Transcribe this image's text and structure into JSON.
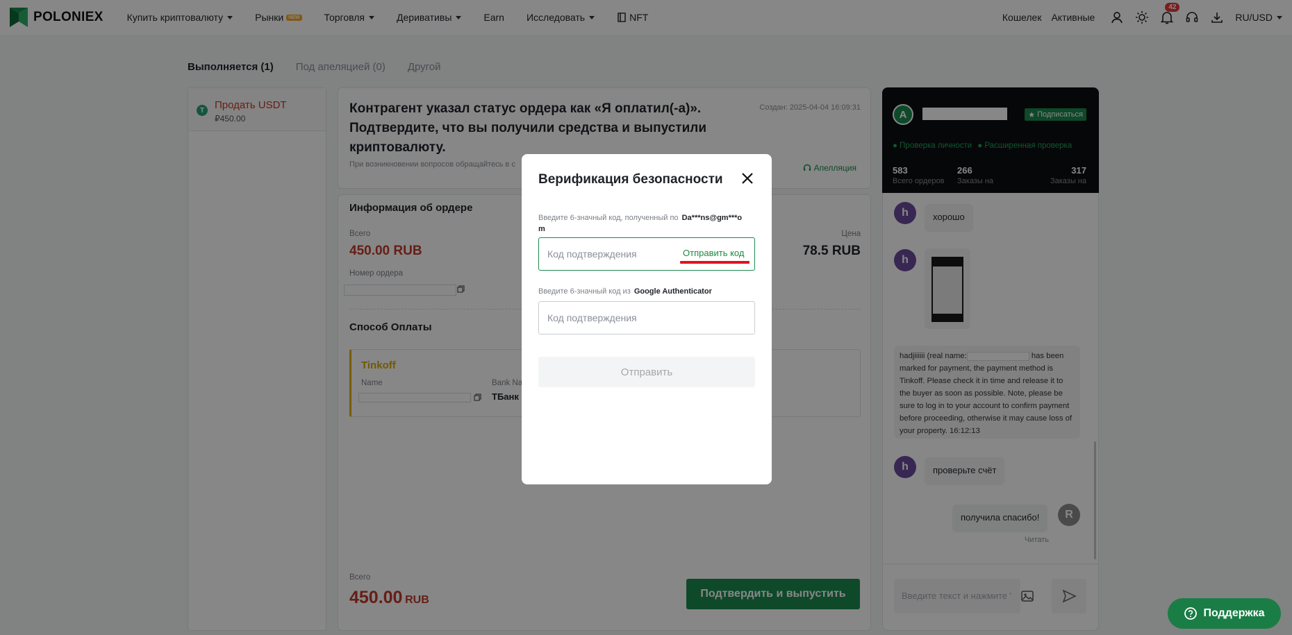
{
  "header": {
    "logo": "POLONIEX",
    "nav": [
      {
        "label": "Купить криптовалюту",
        "caret": true
      },
      {
        "label": "Рынки",
        "badge": "NEW"
      },
      {
        "label": "Торговля",
        "caret": true
      },
      {
        "label": "Деривативы",
        "caret": true
      },
      {
        "label": "Earn"
      },
      {
        "label": "Исследовать",
        "caret": true
      },
      {
        "label": "NFT"
      }
    ],
    "wallet": "Кошелек",
    "assets": "Активные",
    "notifications": "42",
    "currency": "RU/USD"
  },
  "tabs": [
    "Выполняется (1)",
    "Под апеляцией (0)",
    "Другой"
  ],
  "order_list": {
    "title": "Продать USDT",
    "amount": "₽450.00",
    "coin_letter": "T"
  },
  "status": {
    "heading": "Контрагент указал статус ордера как «Я оплатил(-а)». Подтвердите, что вы получили средства и выпустили криптовалюту.",
    "note": "При возникновении вопросов обращайтесь в с",
    "created": "Создан: 2025-04-04 16:09:31",
    "appeal": "Апелляция"
  },
  "order_info": {
    "title": "Информация об ордере",
    "total_label": "Всего",
    "total_value": "450.00 RUB",
    "price_label": "Цена",
    "price_value": "78.5 RUB",
    "order_no_label": "Номер ордера"
  },
  "payment": {
    "title": "Способ Оплаты",
    "method": "Tinkoff",
    "name_label": "Name",
    "bank_label": "Bank Nar",
    "bank_value": "ТБанк"
  },
  "footer": {
    "total_label": "Всего",
    "total_value": "450.00",
    "total_unit": "RUB",
    "confirm": "Подтвердить и выпустить"
  },
  "chat": {
    "subscribe": "Подписаться",
    "avatar_letter": "A",
    "verified": [
      "Проверка личности",
      "Расширенная проверка"
    ],
    "stats": [
      {
        "value": "583",
        "label": "Всего ордеров"
      },
      {
        "value": "266",
        "label": "Заказы на"
      },
      {
        "value": "317",
        "label": "Заказы на"
      }
    ],
    "messages": [
      {
        "from": "h",
        "text": "хорошо"
      },
      {
        "from": "h",
        "text": ""
      },
      {
        "system": "hadjiiiiii (real name:",
        "system_rest": "has been marked for payment, the payment method is Tinkoff. Please check it in time and release it to the buyer as soon as possible. Note, please be sure to log in to your account to confirm payment before proceeding, otherwise it may cause loss of your property. 16:12:13"
      },
      {
        "from": "h",
        "text": "проверьте счёт"
      },
      {
        "from": "R",
        "text": "получила спасибо!",
        "status": "Читать"
      }
    ],
    "input_placeholder": "Введите текст и нажмите '"
  },
  "modal": {
    "title": "Верификация безопасности",
    "email_prompt": "Введите 6-значный код, полученный по",
    "email_masked": "Da***ns@gm***o",
    "email_masked_tail": "m",
    "code_placeholder": "Код подтверждения",
    "send_code": "Отправить код",
    "ga_prompt": "Введите 6-значный код из",
    "ga_name": "Google Authenticator",
    "ga_placeholder": "Код подтверждения",
    "submit": "Отправить"
  },
  "support": "Поддержка",
  "colors": {
    "accent": "#1b8a50",
    "red": "#c0392b",
    "send_code": "#1a8a3f",
    "underline": "#e3131b"
  }
}
